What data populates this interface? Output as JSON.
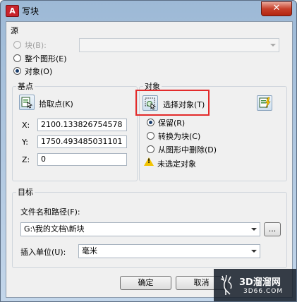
{
  "window": {
    "title": "写块",
    "close_glyph": "✕",
    "icon": "autocad-app-icon"
  },
  "source": {
    "title": "源",
    "options": [
      {
        "label": "块(B):",
        "checked": false,
        "disabled": true
      },
      {
        "label": "整个图形(E)",
        "checked": false,
        "disabled": false
      },
      {
        "label": "对象(O)",
        "checked": true,
        "disabled": false
      }
    ],
    "block_combo_value": ""
  },
  "base_point": {
    "title": "基点",
    "pick_label": "拾取点(K)",
    "x_label": "X:",
    "x_value": "2100.133826754578",
    "y_label": "Y:",
    "y_value": "1750.493485031101",
    "z_label": "Z:",
    "z_value": "0"
  },
  "objects": {
    "title": "对象",
    "select_label": "选择对象(T)",
    "options": [
      {
        "label": "保留(R)",
        "checked": true
      },
      {
        "label": "转换为块(C)",
        "checked": false
      },
      {
        "label": "从图形中删除(D)",
        "checked": false
      }
    ],
    "warning": "未选定对象"
  },
  "target": {
    "title": "目标",
    "path_label": "文件名和路径(F):",
    "path_value": "G:\\我的文档\\新块",
    "browse_label": "...",
    "units_label": "插入单位(U):",
    "units_value": "毫米"
  },
  "buttons": {
    "ok": "确定",
    "cancel": "取消"
  },
  "watermark": {
    "line1": "3D溜溜网",
    "line2": "3D66.COM"
  }
}
